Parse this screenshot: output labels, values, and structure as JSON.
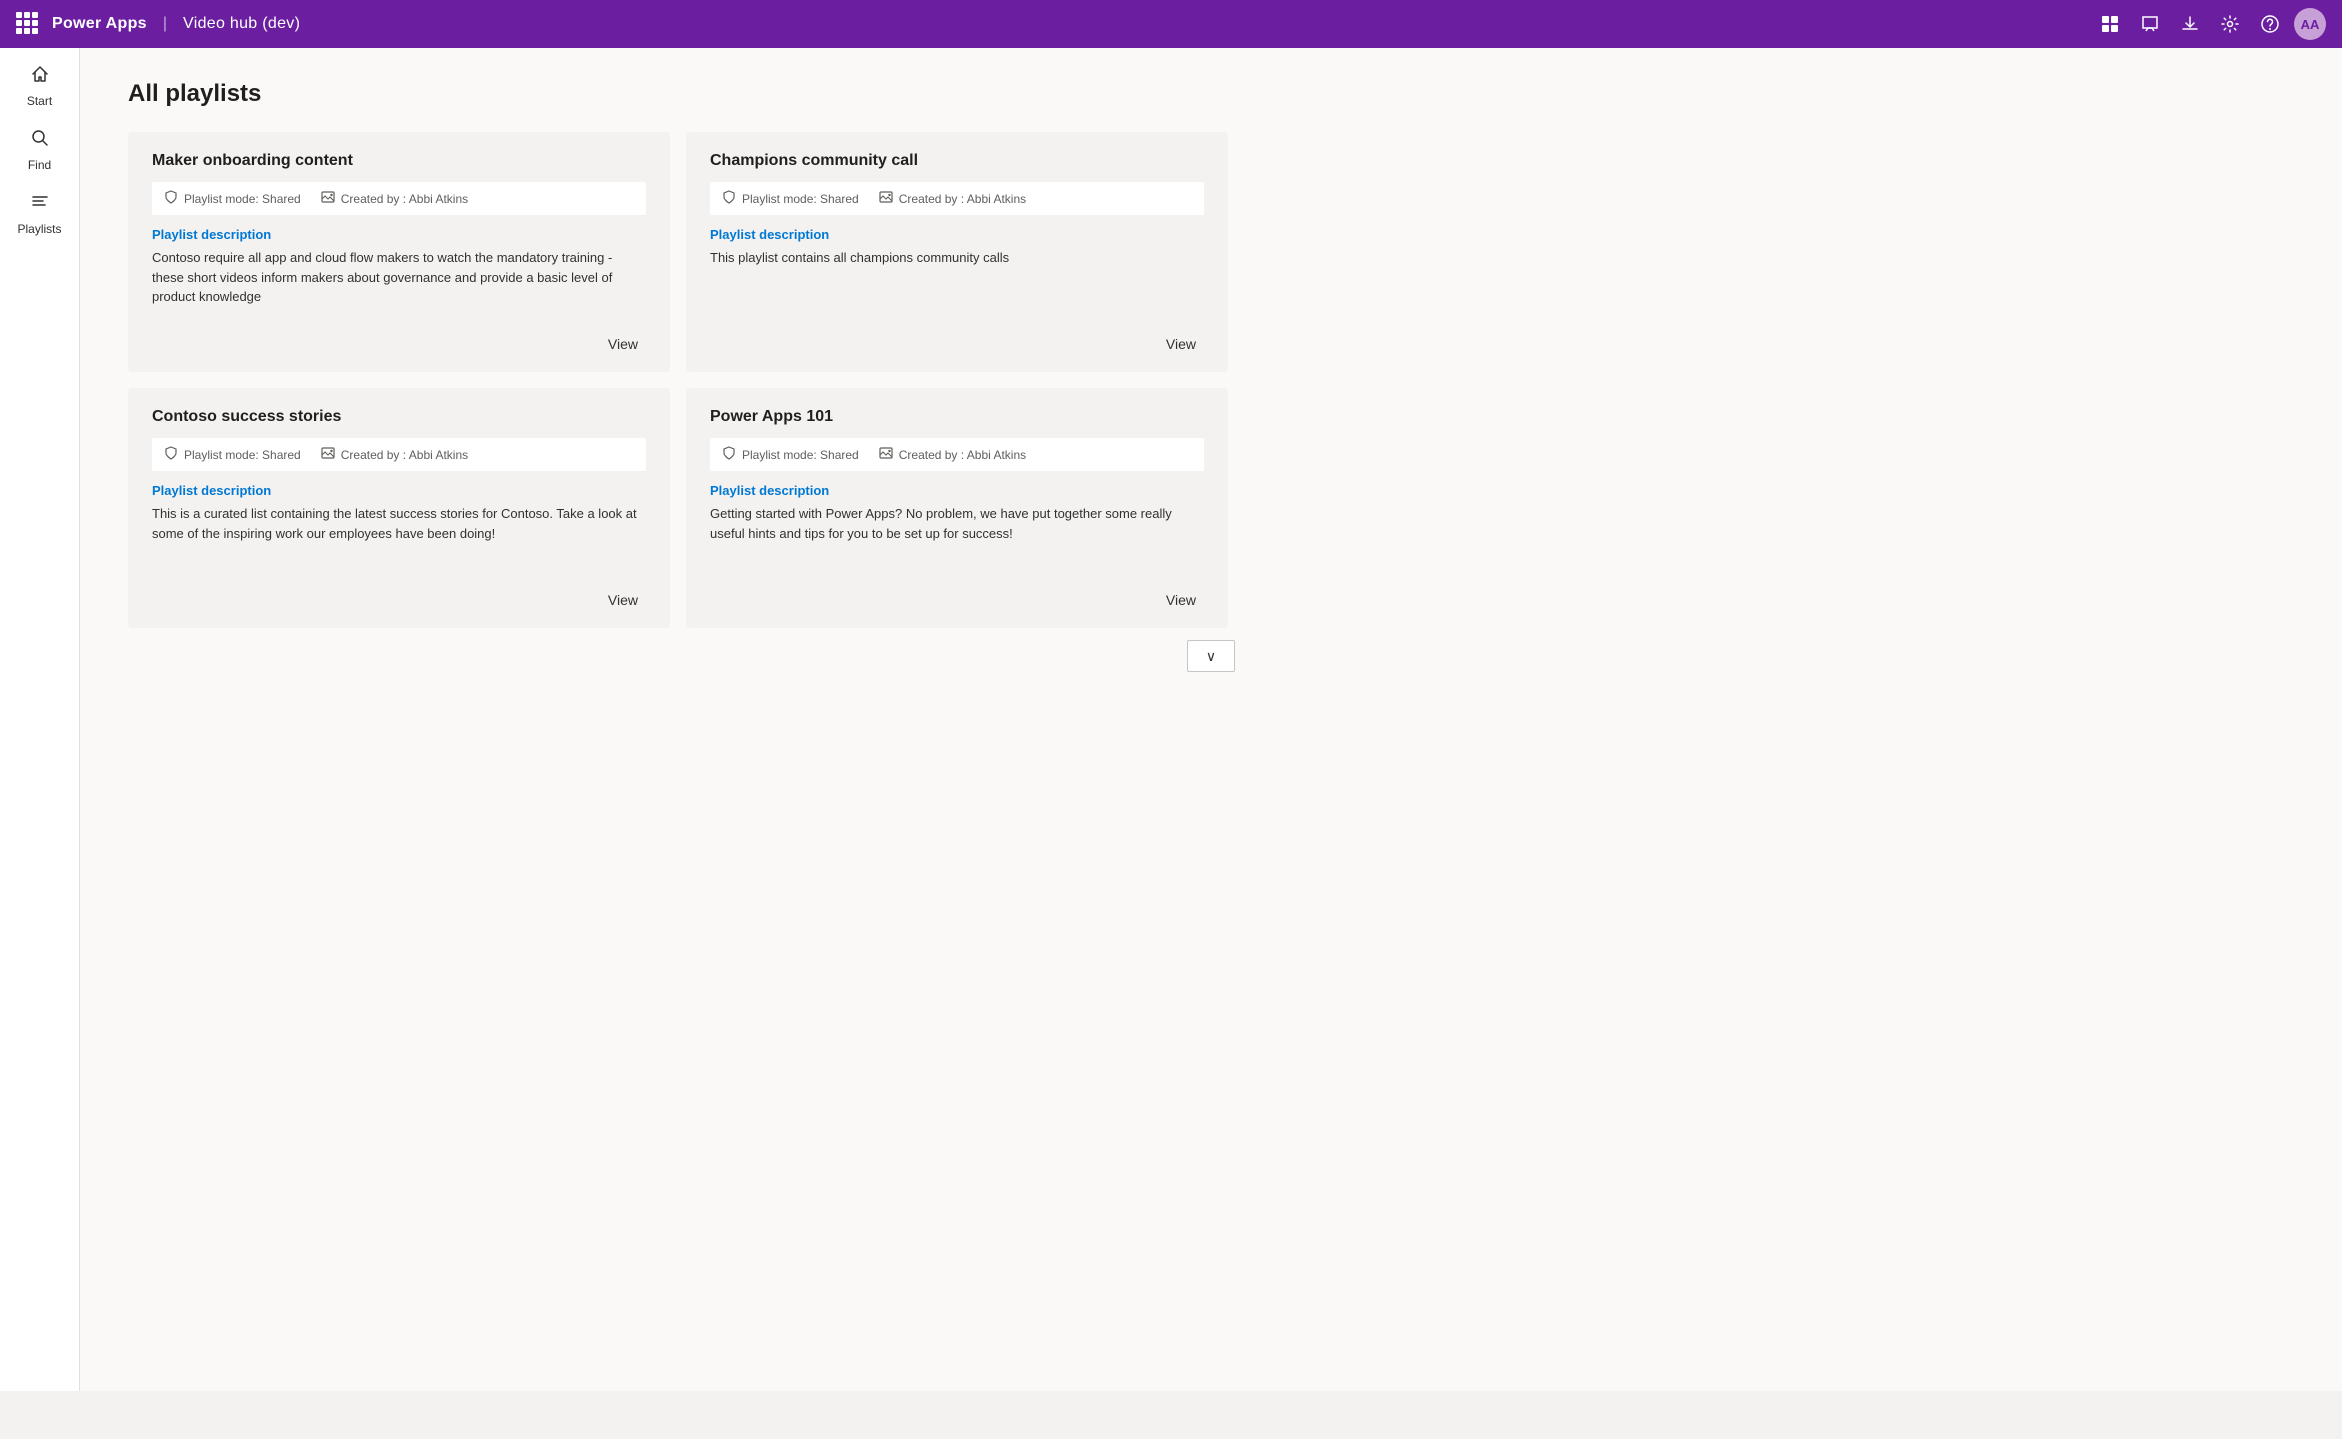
{
  "topNav": {
    "appName": "Power Apps",
    "divider": "|",
    "appContext": "Video hub (dev)",
    "icons": {
      "apps": "⊞",
      "chat": "💬",
      "download": "⬇",
      "settings": "⚙",
      "help": "?",
      "avatar": "AA"
    }
  },
  "sidebar": {
    "items": [
      {
        "id": "start",
        "label": "Start",
        "icon": "⌂"
      },
      {
        "id": "find",
        "label": "Find",
        "icon": "🔍"
      },
      {
        "id": "playlists",
        "label": "Playlists",
        "icon": "≡"
      }
    ]
  },
  "main": {
    "pageTitle": "All playlists",
    "playlists": [
      {
        "id": "p1",
        "title": "Maker onboarding content",
        "modeLabel": "Playlist mode: Shared",
        "creatorLabel": "Created by : Abbi Atkins",
        "descLabel": "Playlist description",
        "descText": "Contoso require all app and cloud flow makers to watch the mandatory training - these short videos inform makers about governance and provide a basic level of product knowledge",
        "viewLabel": "View"
      },
      {
        "id": "p2",
        "title": "Champions community call",
        "modeLabel": "Playlist mode: Shared",
        "creatorLabel": "Created by : Abbi Atkins",
        "descLabel": "Playlist description",
        "descText": "This playlist contains all champions community calls",
        "viewLabel": "View"
      },
      {
        "id": "p3",
        "title": "Contoso success stories",
        "modeLabel": "Playlist mode: Shared",
        "creatorLabel": "Created by : Abbi Atkins",
        "descLabel": "Playlist description",
        "descText": "This is a curated list containing the latest success stories for Contoso.  Take a look at some of the inspiring work our employees have been doing!",
        "viewLabel": "View"
      },
      {
        "id": "p4",
        "title": "Power Apps 101",
        "modeLabel": "Playlist mode: Shared",
        "creatorLabel": "Created by : Abbi Atkins",
        "descLabel": "Playlist description",
        "descText": "Getting started with Power Apps?  No problem, we have put together some really useful hints and tips for you to be set up for success!",
        "viewLabel": "View"
      }
    ],
    "scrollButton": "∨"
  }
}
